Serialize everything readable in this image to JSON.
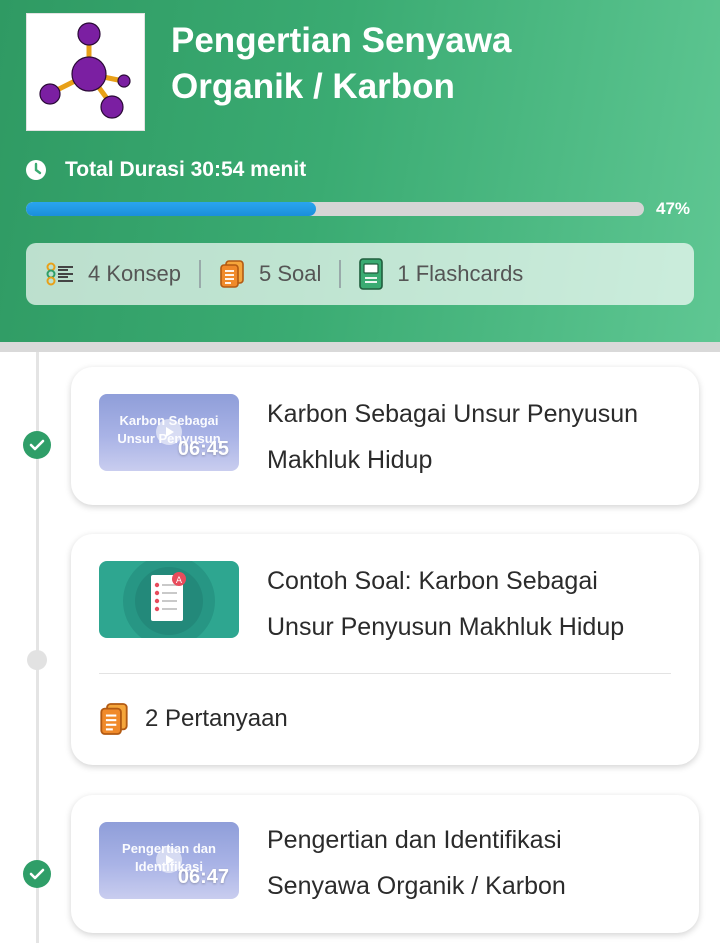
{
  "header": {
    "title_line1": "Pengertian Senyawa",
    "title_line2": "Organik / Karbon",
    "duration_label": "Total Durasi 30:54 menit",
    "progress_percent": 47,
    "progress_label": "47%"
  },
  "stats": [
    {
      "icon": "concept-list-icon",
      "label": "4 Konsep"
    },
    {
      "icon": "question-cards-icon",
      "label": "5 Soal"
    },
    {
      "icon": "flashcard-icon",
      "label": "1 Flashcards"
    }
  ],
  "items": [
    {
      "status": "completed",
      "type": "video",
      "thumb_text": "Karbon Sebagai Unsur Penyusun",
      "duration": "06:45",
      "title_line1": "Karbon Sebagai Unsur Penyusun",
      "title_line2": "Makhluk Hidup"
    },
    {
      "status": "pending",
      "type": "quiz",
      "title_line1": "Contoh Soal: Karbon Sebagai",
      "title_line2": "Unsur Penyusun Makhluk Hidup",
      "question_count": "2 Pertanyaan"
    },
    {
      "status": "completed",
      "type": "video",
      "thumb_text": "Pengertian dan Identifikasi",
      "duration": "06:47",
      "title_line1": "Pengertian dan Identifikasi",
      "title_line2": "Senyawa Organik / Karbon"
    }
  ],
  "colors": {
    "header_green": "#3aab72",
    "progress_blue": "#1b8fdb",
    "check_green": "#2f9e68",
    "quiz_teal": "#2ea690",
    "molecule_purple": "#7b1fa2",
    "bond_orange": "#e8a018"
  }
}
